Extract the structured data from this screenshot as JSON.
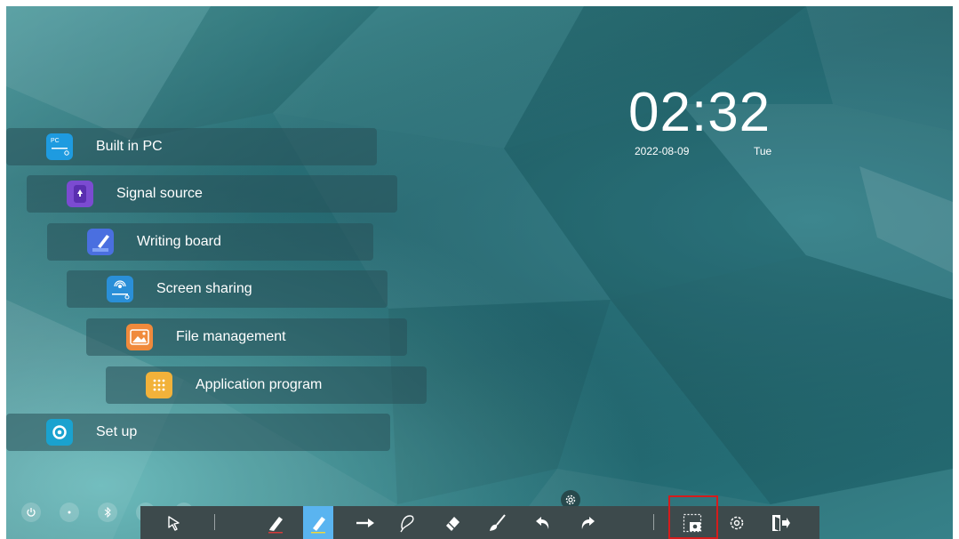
{
  "clock": {
    "time": "02:32",
    "date": "2022-08-09",
    "weekday": "Tue"
  },
  "menu": [
    {
      "label": "Built in PC",
      "icon": "pc-icon",
      "icon_text": "PC",
      "color": "#1e9be0"
    },
    {
      "label": "Signal source",
      "icon": "signal-source-icon",
      "color": "#7b4bd1"
    },
    {
      "label": "Writing board",
      "icon": "writing-board-icon",
      "color": "#4a6fe0"
    },
    {
      "label": "Screen sharing",
      "icon": "screen-sharing-icon",
      "color": "#2a8fd8"
    },
    {
      "label": "File management",
      "icon": "file-management-icon",
      "color": "#f08a3c"
    },
    {
      "label": "Application program",
      "icon": "application-program-icon",
      "color": "#f2b23a"
    },
    {
      "label": "Set up",
      "icon": "set-up-icon",
      "color": "#1aa2cf"
    }
  ],
  "status_icons": [
    "power-icon",
    "dot-icon",
    "bluetooth-icon",
    "display-icon",
    "lock-icon"
  ],
  "toolbar": {
    "tools": [
      "select-icon",
      "pen-icon",
      "highlighter-icon",
      "arrow-icon",
      "lasso-icon",
      "eraser-icon",
      "clear-brush-icon",
      "undo-icon",
      "redo-icon",
      "screenshot-icon",
      "settings-icon",
      "exit-icon"
    ],
    "active_tool": "highlighter-icon",
    "highlighted_tool": "screenshot-icon",
    "accent_color": "#5ab4f0",
    "highlight_color": "#d51c1c"
  }
}
